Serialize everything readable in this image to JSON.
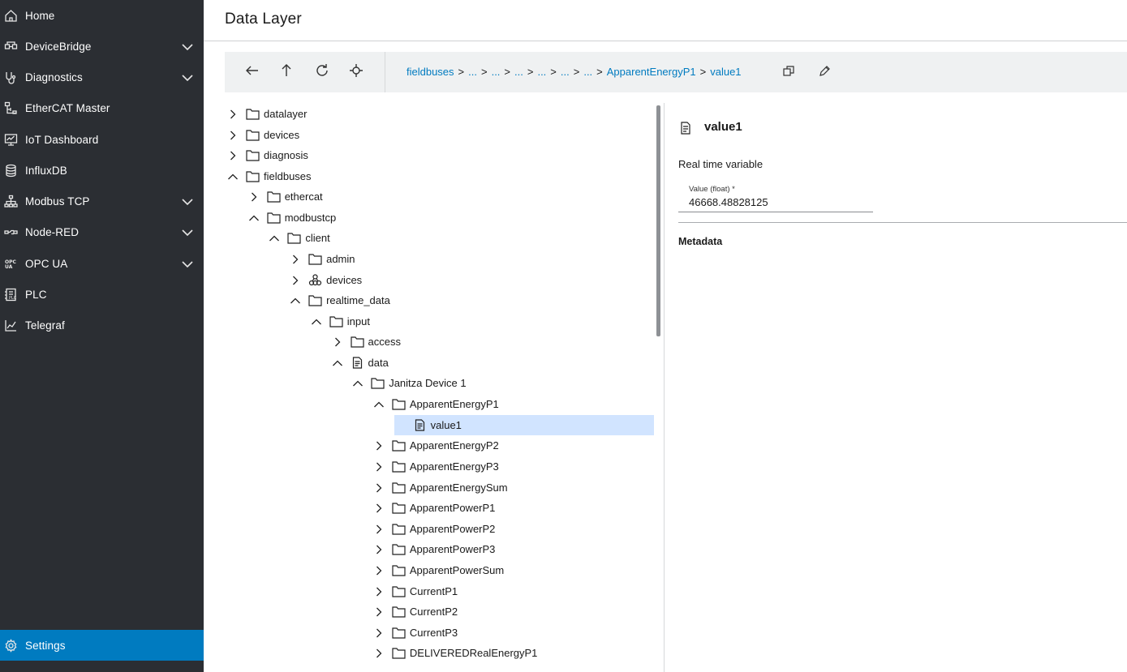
{
  "sidebar": {
    "items": [
      {
        "label": "Home",
        "icon": "home-icon",
        "expandable": false
      },
      {
        "label": "DeviceBridge",
        "icon": "device-bridge-icon",
        "expandable": true
      },
      {
        "label": "Diagnostics",
        "icon": "diagnostics-icon",
        "expandable": true
      },
      {
        "label": "EtherCAT Master",
        "icon": "ethercat-icon",
        "expandable": false
      },
      {
        "label": "IoT Dashboard",
        "icon": "dashboard-icon",
        "expandable": false
      },
      {
        "label": "InfluxDB",
        "icon": "database-icon",
        "expandable": false
      },
      {
        "label": "Modbus TCP",
        "icon": "network-icon",
        "expandable": true
      },
      {
        "label": "Node-RED",
        "icon": "node-red-icon",
        "expandable": true
      },
      {
        "label": "OPC UA",
        "icon": "opc-ua-icon",
        "expandable": true
      },
      {
        "label": "PLC",
        "icon": "plc-icon",
        "expandable": false
      },
      {
        "label": "Telegraf",
        "icon": "chart-icon",
        "expandable": false
      }
    ],
    "settings": {
      "label": "Settings",
      "icon": "gear-icon"
    },
    "accent_color": "#007bc0",
    "background_color": "#2b2e33"
  },
  "header": {
    "title": "Data Layer"
  },
  "toolbar": {
    "buttons": [
      "back-arrow-icon",
      "up-arrow-icon",
      "refresh-icon",
      "locate-icon"
    ],
    "breadcrumb": [
      "fieldbuses",
      "...",
      "...",
      "...",
      "...",
      "...",
      "...",
      "ApparentEnergyP1",
      "value1"
    ],
    "separator": ">"
  },
  "tree": {
    "nodes": [
      {
        "label": "datalayer",
        "type": "folder",
        "expanded": false
      },
      {
        "label": "devices",
        "type": "folder",
        "expanded": false
      },
      {
        "label": "diagnosis",
        "type": "folder",
        "expanded": false
      },
      {
        "label": "fieldbuses",
        "type": "folder",
        "expanded": true
      },
      {
        "label": "ethercat",
        "type": "folder",
        "expanded": false
      },
      {
        "label": "modbustcp",
        "type": "folder",
        "expanded": true
      },
      {
        "label": "client",
        "type": "folder",
        "expanded": true
      },
      {
        "label": "admin",
        "type": "folder",
        "expanded": false
      },
      {
        "label": "devices",
        "type": "nodes",
        "expanded": false
      },
      {
        "label": "realtime_data",
        "type": "folder",
        "expanded": true
      },
      {
        "label": "input",
        "type": "folder",
        "expanded": true
      },
      {
        "label": "access",
        "type": "folder",
        "expanded": false
      },
      {
        "label": "data",
        "type": "file",
        "expanded": true
      },
      {
        "label": "Janitza Device 1",
        "type": "folder",
        "expanded": true
      },
      {
        "label": "ApparentEnergyP1",
        "type": "folder",
        "expanded": true
      },
      {
        "label": "value1",
        "type": "file",
        "expanded": null,
        "selected": true
      },
      {
        "label": "ApparentEnergyP2",
        "type": "folder",
        "expanded": false
      },
      {
        "label": "ApparentEnergyP3",
        "type": "folder",
        "expanded": false
      },
      {
        "label": "ApparentEnergySum",
        "type": "folder",
        "expanded": false
      },
      {
        "label": "ApparentPowerP1",
        "type": "folder",
        "expanded": false
      },
      {
        "label": "ApparentPowerP2",
        "type": "folder",
        "expanded": false
      },
      {
        "label": "ApparentPowerP3",
        "type": "folder",
        "expanded": false
      },
      {
        "label": "ApparentPowerSum",
        "type": "folder",
        "expanded": false
      },
      {
        "label": "CurrentP1",
        "type": "folder",
        "expanded": false
      },
      {
        "label": "CurrentP2",
        "type": "folder",
        "expanded": false
      },
      {
        "label": "CurrentP3",
        "type": "folder",
        "expanded": false
      },
      {
        "label": "DELIVEREDRealEnergyP1",
        "type": "folder",
        "expanded": false
      }
    ],
    "selected_color": "#d1e4ff"
  },
  "detail": {
    "title": "value1",
    "type_label": "Real time variable",
    "value_label": "Value (float) *",
    "value": "46668.48828125",
    "metadata_heading": "Metadata"
  }
}
